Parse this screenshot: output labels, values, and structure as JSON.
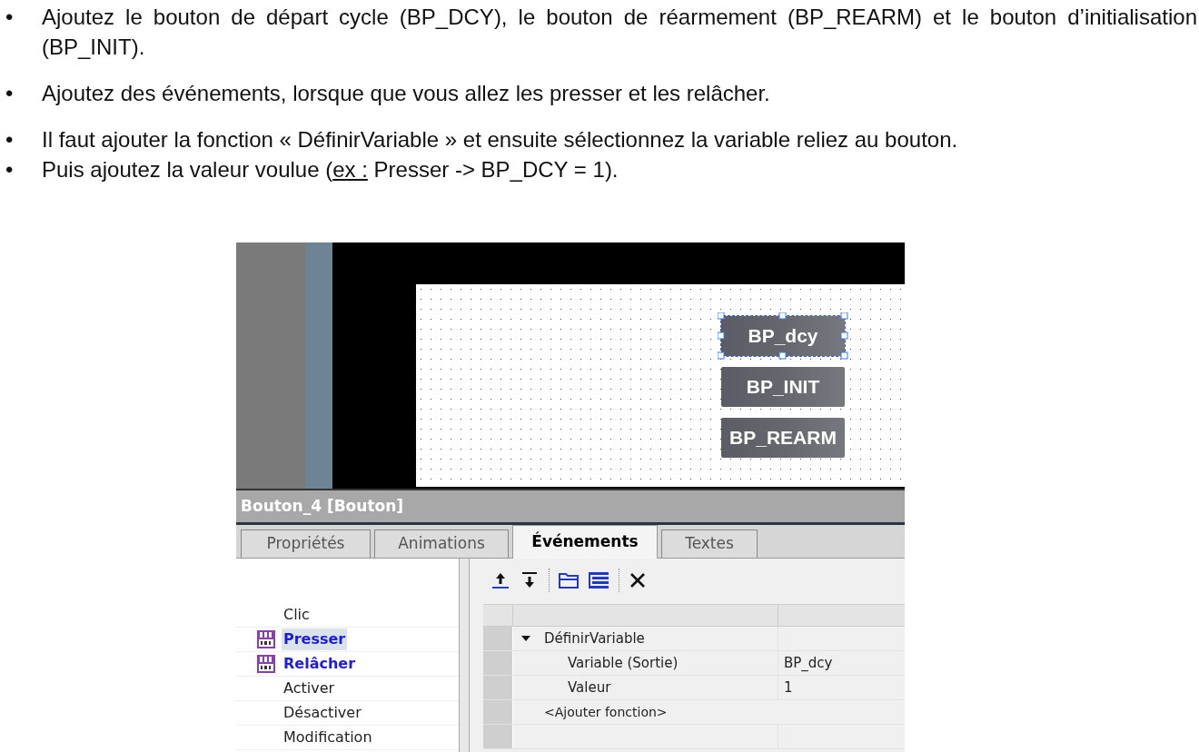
{
  "instructions": [
    [
      {
        "segments": [
          {
            "text": "Ajoutez le bouton de départ cycle (BP_DCY), le bouton de réarmement (BP_REARM) et le bouton d’initialisation (BP_INIT).",
            "underline": false
          }
        ]
      }
    ],
    [
      {
        "segments": [
          {
            "text": "Ajoutez des événements, lorsque que vous allez les presser et les relâcher.",
            "underline": false
          }
        ]
      }
    ],
    [
      {
        "segments": [
          {
            "text": "Il faut ajouter la fonction « DéfinirVariable » et ensuite sélectionnez la variable reliez au bouton.",
            "underline": false
          }
        ]
      },
      {
        "segments": [
          {
            "text": "Puis ajoutez la valeur voulue (",
            "underline": false
          },
          {
            "text": "ex :",
            "underline": true
          },
          {
            "text": " Presser -> BP_DCY = 1).",
            "underline": false
          }
        ]
      }
    ]
  ],
  "bullet": "•",
  "screenshot": {
    "canvas_buttons": [
      {
        "label": "BP_dcy",
        "selected": true
      },
      {
        "label": "BP_INIT",
        "selected": false
      },
      {
        "label": "BP_REARM",
        "selected": false
      }
    ],
    "inspector_title": "Bouton_4 [Bouton]",
    "tabs": [
      {
        "label": "Propriétés",
        "selected": false
      },
      {
        "label": "Animations",
        "selected": false
      },
      {
        "label": "Événements",
        "selected": true
      },
      {
        "label": "Textes",
        "selected": false
      }
    ],
    "events": [
      {
        "label": "Clic",
        "has_function": false,
        "selected": false
      },
      {
        "label": "Presser",
        "has_function": true,
        "selected": true
      },
      {
        "label": "Relâcher",
        "has_function": true,
        "selected": false
      },
      {
        "label": "Activer",
        "has_function": false,
        "selected": false
      },
      {
        "label": "Désactiver",
        "has_function": false,
        "selected": false
      },
      {
        "label": "Modification",
        "has_function": false,
        "selected": false
      }
    ],
    "function_rows": [
      {
        "kind": "function",
        "expanded": true,
        "name": "DéfinirVariable"
      },
      {
        "kind": "param",
        "name": "Variable (Sortie)",
        "value": "BP_dcy"
      },
      {
        "kind": "param",
        "name": "Valeur",
        "value": "1"
      },
      {
        "kind": "add",
        "name": "<Ajouter fonction>"
      },
      {
        "kind": "empty"
      }
    ]
  }
}
